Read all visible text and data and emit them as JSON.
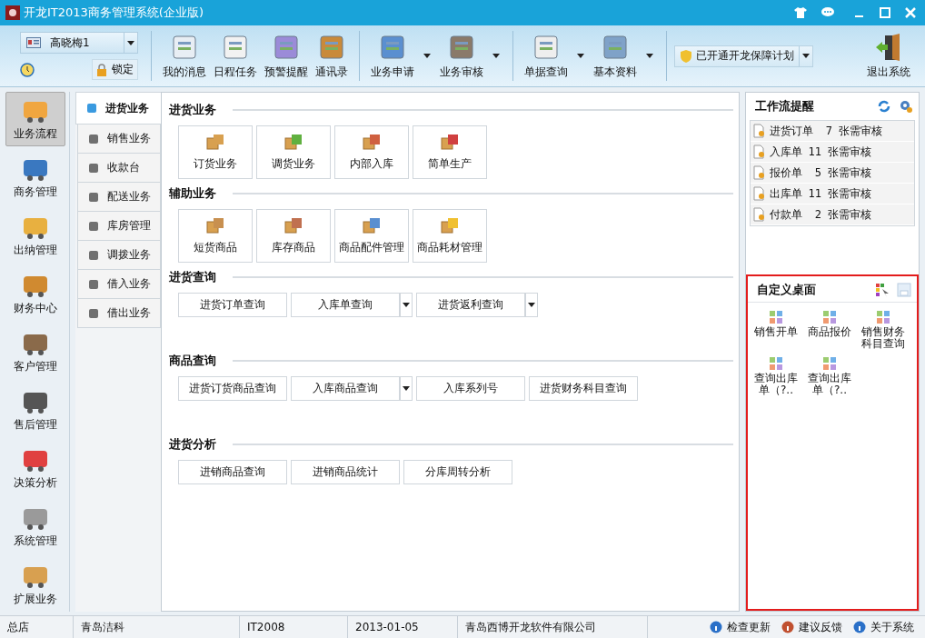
{
  "window": {
    "title": "开龙IT2013商务管理系统(企业版)"
  },
  "user": {
    "name": "高晓梅1",
    "lock_label": "锁定"
  },
  "toolbar": {
    "groups": [
      [
        {
          "label": "我的消息",
          "dropdown": false
        },
        {
          "label": "日程任务",
          "dropdown": false
        },
        {
          "label": "预警提醒",
          "dropdown": false
        },
        {
          "label": "通讯录",
          "dropdown": false
        }
      ],
      [
        {
          "label": "业务申请",
          "dropdown": true
        },
        {
          "label": "业务审核",
          "dropdown": true
        }
      ],
      [
        {
          "label": "单据查询",
          "dropdown": true
        },
        {
          "label": "基本资料",
          "dropdown": true
        }
      ]
    ],
    "plan": {
      "label": "已开通开龙保障计划"
    },
    "exit": {
      "label": "退出系统"
    }
  },
  "sidebar": {
    "items": [
      {
        "label": "业务流程",
        "selected": true
      },
      {
        "label": "商务管理",
        "selected": false
      },
      {
        "label": "出纳管理",
        "selected": false
      },
      {
        "label": "财务中心",
        "selected": false
      },
      {
        "label": "客户管理",
        "selected": false
      },
      {
        "label": "售后管理",
        "selected": false
      },
      {
        "label": "决策分析",
        "selected": false
      },
      {
        "label": "系统管理",
        "selected": false
      },
      {
        "label": "扩展业务",
        "selected": false
      }
    ]
  },
  "subnav": {
    "items": [
      {
        "label": "进货业务",
        "selected": true
      },
      {
        "label": "销售业务",
        "selected": false
      },
      {
        "label": "收款台",
        "selected": false
      },
      {
        "label": "配送业务",
        "selected": false
      },
      {
        "label": "库房管理",
        "selected": false
      },
      {
        "label": "调拨业务",
        "selected": false
      },
      {
        "label": "借入业务",
        "selected": false
      },
      {
        "label": "借出业务",
        "selected": false
      }
    ]
  },
  "sections": [
    {
      "title": "进货业务",
      "kind": "tiles",
      "items": [
        {
          "label": "订货业务"
        },
        {
          "label": "调货业务"
        },
        {
          "label": "内部入库"
        },
        {
          "label": "简单生产"
        }
      ]
    },
    {
      "title": "辅助业务",
      "kind": "tiles",
      "items": [
        {
          "label": "短货商品"
        },
        {
          "label": "库存商品"
        },
        {
          "label": "商品配件管理"
        },
        {
          "label": "商品耗材管理"
        }
      ]
    },
    {
      "title": "进货查询",
      "kind": "buttons",
      "items": [
        {
          "label": "进货订单查询",
          "dropdown": false
        },
        {
          "label": "入库单查询",
          "dropdown": true
        },
        {
          "label": "进货返利查询",
          "dropdown": true
        }
      ]
    },
    {
      "title": "商品查询",
      "kind": "buttons",
      "items": [
        {
          "label": "进货订货商品查询",
          "dropdown": false
        },
        {
          "label": "入库商品查询",
          "dropdown": true
        },
        {
          "label": "入库系列号",
          "dropdown": false
        },
        {
          "label": "进货财务科目查询",
          "dropdown": false
        }
      ]
    },
    {
      "title": "进货分析",
      "kind": "buttons",
      "items": [
        {
          "label": "进销商品查询",
          "dropdown": false
        },
        {
          "label": "进销商品统计",
          "dropdown": false
        },
        {
          "label": "分库周转分析",
          "dropdown": false
        }
      ]
    }
  ],
  "workflow": {
    "title": "工作流提醒",
    "items": [
      {
        "doc": "进货订单",
        "count": "7",
        "note": "张需审核"
      },
      {
        "doc": "入库单",
        "count": "11",
        "note": "张需审核"
      },
      {
        "doc": "报价单",
        "count": "5",
        "note": "张需审核"
      },
      {
        "doc": "出库单",
        "count": "11",
        "note": "张需审核"
      },
      {
        "doc": "付款单",
        "count": "2",
        "note": "张需审核"
      }
    ]
  },
  "desktop": {
    "title": "自定义桌面",
    "highlighted": true,
    "items": [
      {
        "label": "销售开单"
      },
      {
        "label": "商品报价"
      },
      {
        "label": "销售财务科目查询"
      },
      {
        "label": "查询出库单（?.."
      },
      {
        "label": "查询出库单（?.."
      }
    ]
  },
  "status_bar": {
    "cells": [
      "总店",
      "青岛洁科",
      "IT2008",
      "2013-01-05",
      "青岛西博开龙软件有限公司"
    ],
    "links": [
      {
        "label": "检查更新"
      },
      {
        "label": "建议反馈"
      },
      {
        "label": "关于系统"
      }
    ]
  }
}
